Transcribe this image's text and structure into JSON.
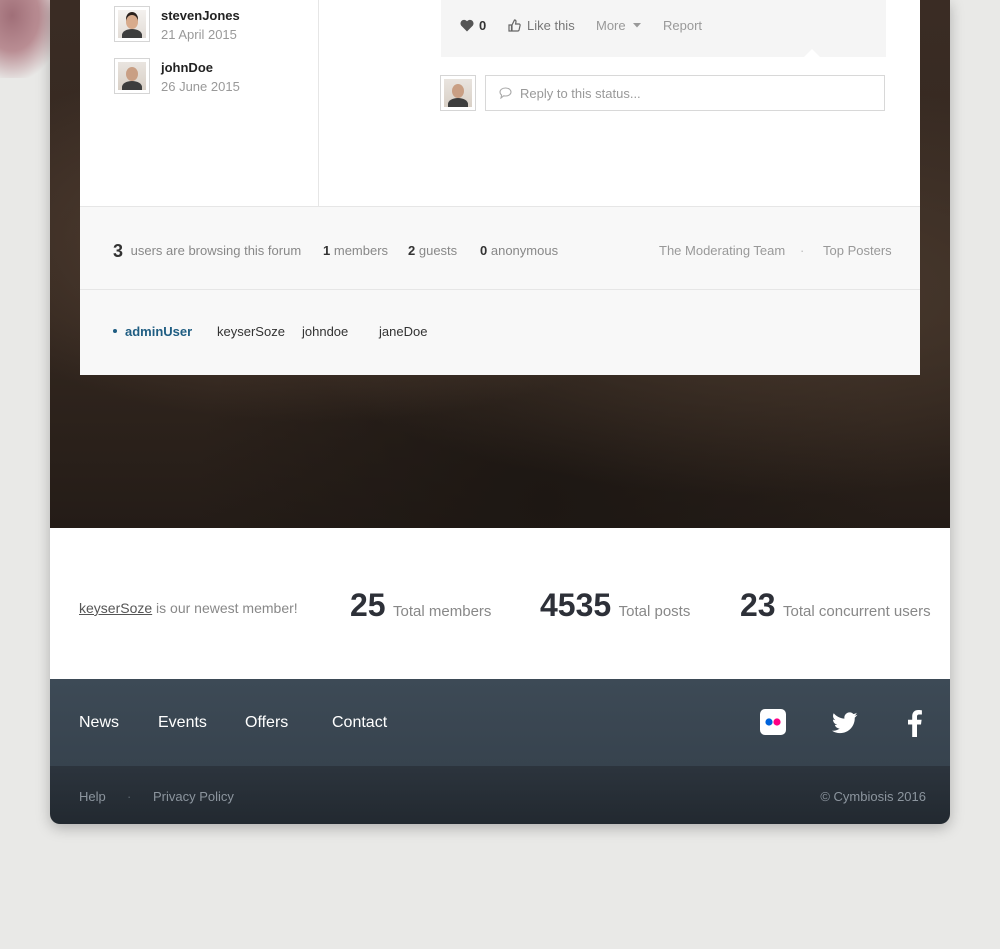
{
  "recent_posters": [
    {
      "name": "stevenJones",
      "date": "21 April 2015"
    },
    {
      "name": "johnDoe",
      "date": "26 June 2015"
    }
  ],
  "status_actions": {
    "like_count": "0",
    "like_label": "Like this",
    "more_label": "More",
    "report_label": "Report"
  },
  "reply": {
    "placeholder": "Reply to this status..."
  },
  "browsing": {
    "total": "3",
    "total_label": "users are browsing this forum",
    "members_count": "1",
    "members_label": "members",
    "guests_count": "2",
    "guests_label": "guests",
    "anon_count": "0",
    "anon_label": "anonymous",
    "moderating_team": "The Moderating Team",
    "separator": "·",
    "top_posters": "Top Posters"
  },
  "online_users": [
    "adminUser",
    "keyserSoze",
    "johndoe",
    "janeDoe"
  ],
  "stats": {
    "newest_member": "keyserSoze",
    "newest_suffix": "is our newest member!",
    "total_members": "25",
    "total_members_label": "Total members",
    "total_posts": "4535",
    "total_posts_label": "Total posts",
    "concurrent": "23",
    "concurrent_label": "Total concurrent users"
  },
  "footer_nav": [
    "News",
    "Events",
    "Offers",
    "Contact"
  ],
  "social_icons": [
    "flickr-icon",
    "twitter-icon",
    "facebook-icon"
  ],
  "footer_bottom": {
    "help": "Help",
    "separator": "·",
    "privacy": "Privacy Policy",
    "copyright": "© Cymbiosis 2016"
  },
  "colors": {
    "accent": "#1f5d82",
    "footer_nav_bg": "#3d4a56",
    "footer_bottom_bg": "#252c33"
  }
}
